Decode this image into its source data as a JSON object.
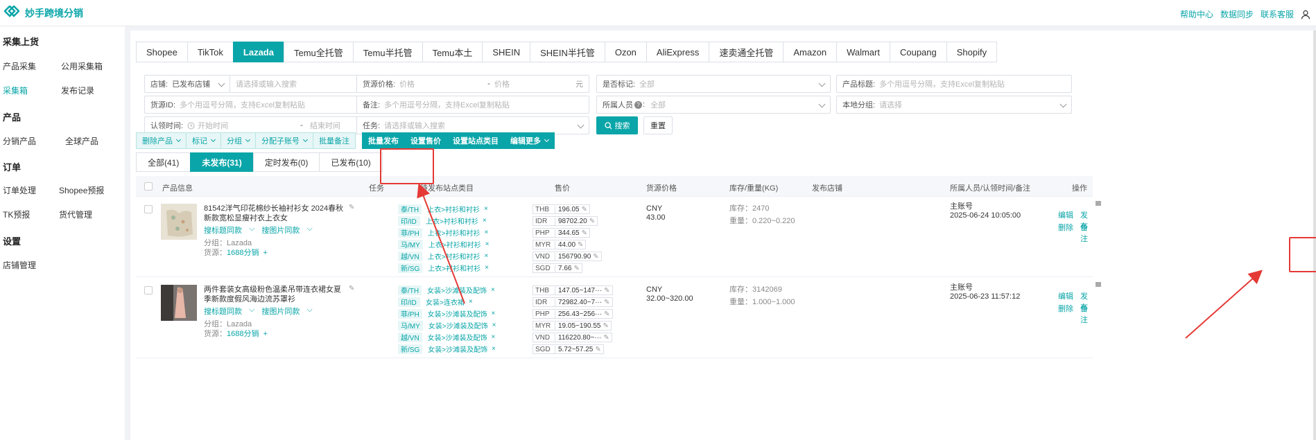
{
  "app": {
    "title": "妙手跨境分销"
  },
  "top_links": [
    "帮助中心",
    "数据同步",
    "联系客服"
  ],
  "sidebar": {
    "sections": [
      {
        "title": "采集上货",
        "items": [
          "产品采集",
          "公用采集箱",
          "采集箱",
          "发布记录"
        ]
      },
      {
        "title": "产品",
        "items": [
          "分销产品",
          "全球产品"
        ]
      },
      {
        "title": "订单",
        "items": [
          "订单处理",
          "Shopee预报",
          "TK预报",
          "货代管理"
        ]
      },
      {
        "title": "设置",
        "items": [
          "店铺管理"
        ]
      }
    ]
  },
  "platform_tabs": [
    "Shopee",
    "TikTok",
    "Lazada",
    "Temu全托管",
    "Temu半托管",
    "Temu本土",
    "SHEIN",
    "SHEIN半托管",
    "Ozon",
    "AliExpress",
    "速卖通全托管",
    "Amazon",
    "Walmart",
    "Coupang",
    "Shopify"
  ],
  "active_platform": "Lazada",
  "filters": {
    "shop": {
      "label": "店铺:",
      "value": "已发布店铺",
      "placeholder": "请选择或输入搜索"
    },
    "source_price": {
      "label": "货源价格:",
      "min_ph": "价格",
      "dash": "-",
      "max_ph": "价格",
      "unit": "元"
    },
    "marked": {
      "label": "是否标记:",
      "placeholder": "全部"
    },
    "product_title": {
      "label": "产品标题:",
      "placeholder": "多个用逗号分隔，支持Excel复制粘贴"
    },
    "source_id": {
      "label": "货源ID:",
      "placeholder": "多个用逗号分隔，支持Excel复制粘贴"
    },
    "remark": {
      "label": "备注:",
      "placeholder": "多个用逗号分隔，支持Excel复制粘贴"
    },
    "owner": {
      "label": "所属人员",
      "help": "?",
      "colon": ":",
      "placeholder": "全部"
    },
    "local_group": {
      "label": "本地分组:",
      "placeholder": "请选择"
    },
    "claim_time": {
      "label": "认领时间:",
      "start_ph": "开始时间",
      "dash": "-",
      "end_ph": "结束时间"
    },
    "task": {
      "label": "任务:",
      "placeholder": "请选择或输入搜索"
    },
    "search_btn": "搜索",
    "reset_btn": "重置"
  },
  "action_bar": [
    "删除产品",
    "标记",
    "分组",
    "分配子账号",
    "批量备注",
    "批量发布",
    "设置售价",
    "设置站点类目",
    "编辑更多"
  ],
  "status_tabs": [
    "全部(41)",
    "未发布(31)",
    "定时发布(0)",
    "已发布(10)"
  ],
  "table_headers": {
    "product": "产品信息",
    "task": "任务",
    "site_cat": "待发布站点类目",
    "price": "售价",
    "source_price": "货源价格",
    "stock": "库存/重量(KG)",
    "shop": "发布店铺",
    "owner": "所属人员/认领时间/备注",
    "ops": "操作"
  },
  "rows": [
    {
      "title": "81542洋气印花棉纱长袖衬衫女 2024春秋新款宽松显瘦衬衣上衣女",
      "search_title": "搜标题同款",
      "search_image": "搜图片同款",
      "group": "分组：Lazada",
      "source_label": "货源：",
      "source": "1688分销",
      "sites": [
        {
          "code": "泰/TH",
          "cat": "上衣>衬衫和衬衫"
        },
        {
          "code": "印/ID",
          "cat": "上衣>衬衫和衬衫"
        },
        {
          "code": "菲/PH",
          "cat": "上衣>衬衫和衬衫"
        },
        {
          "code": "马/MY",
          "cat": "上衣>衬衫和衬衫"
        },
        {
          "code": "越/VN",
          "cat": "上衣>衬衫和衬衫"
        },
        {
          "code": "新/SG",
          "cat": "上衣>衬衫和衬衫"
        }
      ],
      "prices": [
        {
          "cur": "THB",
          "val": "196.05"
        },
        {
          "cur": "IDR",
          "val": "98702.20"
        },
        {
          "cur": "PHP",
          "val": "344.65"
        },
        {
          "cur": "MYR",
          "val": "44.00"
        },
        {
          "cur": "VND",
          "val": "156790.90"
        },
        {
          "cur": "SGD",
          "val": "7.66"
        }
      ],
      "src_cur": "CNY",
      "src_price": "43.00",
      "stock": "库存：2470",
      "weight": "重量：0.220~0.220",
      "owner": "主账号",
      "time": "2025-06-24 10:05:00",
      "ops": [
        "编辑",
        "发布",
        "删除",
        "备注"
      ]
    },
    {
      "title": "两件套装女高级粉色温柔吊带连衣裙女夏季新款度假风海边流苏罩衫",
      "search_title": "搜标题同款",
      "search_image": "搜图片同款",
      "group": "分组：Lazada",
      "source_label": "货源：",
      "source": "1688分销",
      "sites": [
        {
          "code": "泰/TH",
          "cat": "女装>沙滩装及配饰"
        },
        {
          "code": "印/ID",
          "cat": "女装>连衣裙"
        },
        {
          "code": "菲/PH",
          "cat": "女装>沙滩装及配饰"
        },
        {
          "code": "马/MY",
          "cat": "女装>沙滩装及配饰"
        },
        {
          "code": "越/VN",
          "cat": "女装>沙滩装及配饰"
        },
        {
          "code": "新/SG",
          "cat": "女装>沙滩装及配饰"
        }
      ],
      "prices": [
        {
          "cur": "THB",
          "val": "147.05~147···"
        },
        {
          "cur": "IDR",
          "val": "72982.40~7···"
        },
        {
          "cur": "PHP",
          "val": "256.43~256···"
        },
        {
          "cur": "MYR",
          "val": "19.05~190.55"
        },
        {
          "cur": "VND",
          "val": "116220.80~···"
        },
        {
          "cur": "SGD",
          "val": "5.72~57.25"
        }
      ],
      "src_cur": "CNY",
      "src_price": "32.00~320.00",
      "stock": "库存：3142069",
      "weight": "重量：1.000~1.000",
      "owner": "主账号",
      "time": "2025-06-23 11:57:12",
      "ops": [
        "编辑",
        "发布",
        "删除",
        "备注"
      ]
    }
  ],
  "colors": {
    "accent": "#0aa5a8",
    "highlight": "#e53935"
  }
}
